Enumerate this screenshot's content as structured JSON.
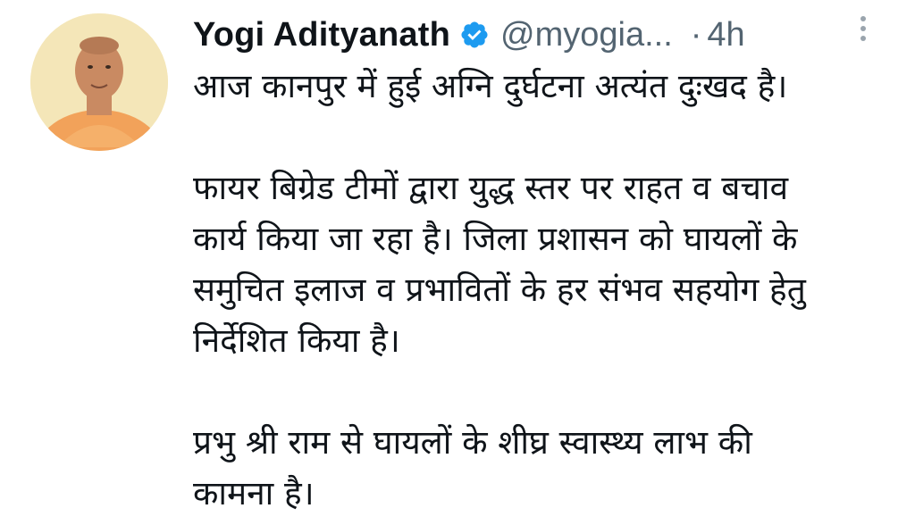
{
  "tweet": {
    "author_name": "Yogi Adityanath",
    "handle": "@myogia...",
    "separator": "·",
    "time": "4h",
    "paragraph1": {
      "line1": "आज कानपुर में हुई अग्नि दुर्घटना अत्यंत दुःखद है।"
    },
    "paragraph2": {
      "line1": "फायर बिग्रेड टीमों द्वारा युद्ध स्तर पर राहत व बचाव",
      "line2": "कार्य किया जा रहा है। जिला प्रशासन को घायलों के",
      "line3": "समुचित इलाज व प्रभावितों के हर संभव सहयोग हेतु",
      "line4": "निर्देशित किया है।"
    },
    "paragraph3": {
      "line1": "प्रभु श्री राम से घायलों के शीघ्र स्वास्थ्य लाभ की",
      "line2": "कामना है।"
    }
  },
  "icons": {
    "verified": "verified-badge-icon",
    "more": "more-options-icon"
  },
  "colors": {
    "text": "#0f1419",
    "secondary": "#536471",
    "verified_blue": "#1d9bf0"
  }
}
